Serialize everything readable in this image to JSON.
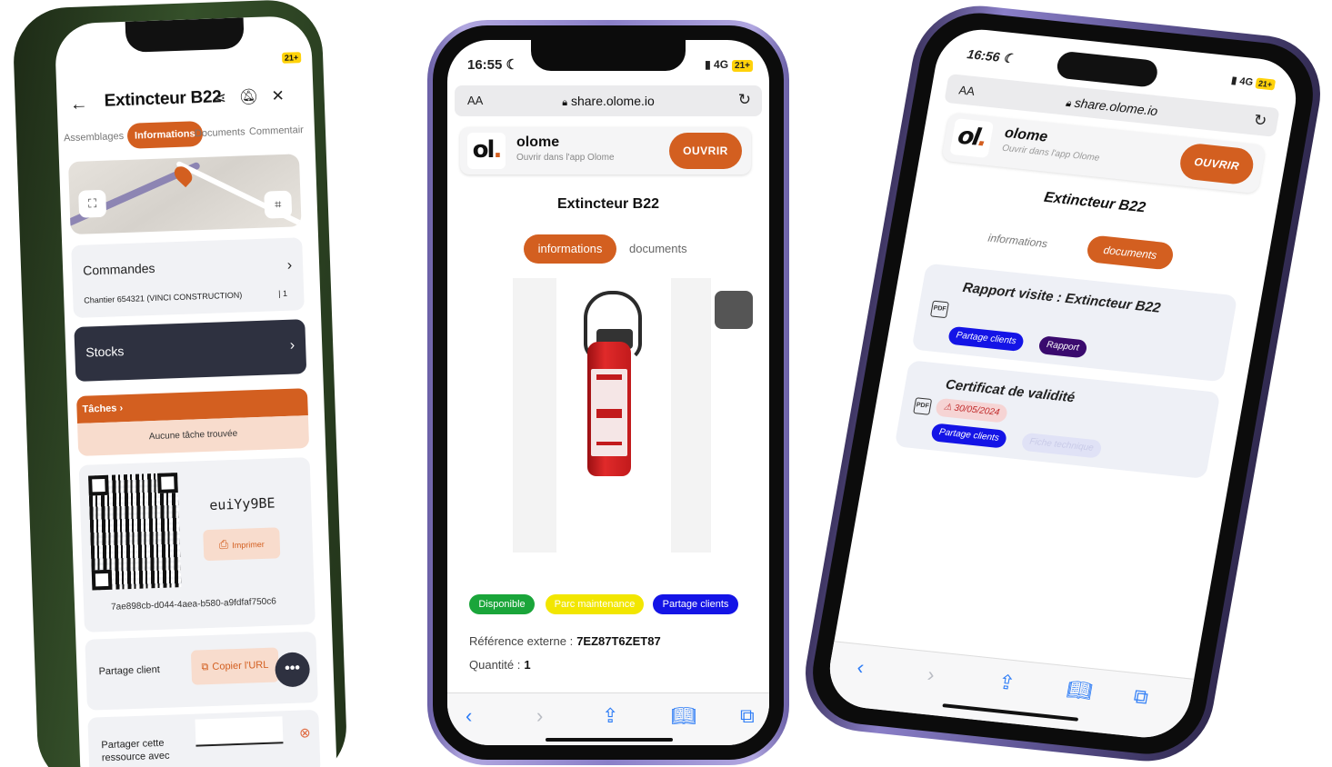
{
  "phone1": {
    "battery": "21+",
    "title": "Extincteur B22",
    "tabs": [
      "Assemblages",
      "Informations",
      "Documents",
      "Commentair"
    ],
    "commandes": {
      "title": "Commandes",
      "detail": "Chantier 654321 (VINCI CONSTRUCTION)",
      "count": "| 1"
    },
    "stocks": {
      "title": "Stocks"
    },
    "taches": {
      "title": "Tâches",
      "empty": "Aucune tâche trouvée"
    },
    "qr": {
      "code": "euiYy9BE",
      "print_label": "Imprimer",
      "uuid": "7ae898cb-d044-4aea-b580-a9fdfaf750c6"
    },
    "share": {
      "label": "Partage client",
      "copy_label": "Copier l'URL",
      "fab": "•••",
      "share_with_line1": "Partager cette",
      "share_with_line2": "ressource avec"
    }
  },
  "phone2": {
    "time": "16:55",
    "network": "4G",
    "battery": "21+",
    "aa": "AA",
    "url": "share.olome.io",
    "brand": "olome",
    "brand_sub": "Ouvrir dans l'app Olome",
    "logo": "ol",
    "open_label": "OUVRIR",
    "title": "Extincteur B22",
    "tab_active": "informations",
    "tab_other": "documents",
    "badges": [
      {
        "label": "Disponible",
        "bg": "#1aa53a",
        "fg": "#ffffff"
      },
      {
        "label": "Parc maintenance",
        "bg": "#f2e600",
        "fg": "#ffffff"
      },
      {
        "label": "Partage clients",
        "bg": "#1414e6",
        "fg": "#ffffff"
      }
    ],
    "ref_label": "Référence externe :",
    "ref_value": "7EZ87T6ZET87",
    "qty_label": "Quantité :",
    "qty_value": "1"
  },
  "phone3": {
    "time": "16:56",
    "network": "4G",
    "battery": "21+",
    "aa": "AA",
    "url": "share.olome.io",
    "brand": "olome",
    "brand_sub": "Ouvrir dans l'app Olome",
    "logo": "ol",
    "open_label": "OUVRIR",
    "title": "Extincteur B22",
    "tab_other": "informations",
    "tab_active": "documents",
    "doc1": {
      "title": "Rapport visite : Extincteur B22",
      "badges": [
        "Partage clients",
        "Rapport"
      ]
    },
    "doc2": {
      "title": "Certificat de validité",
      "date": "30/05/2024",
      "badges": [
        "Partage clients",
        "Fiche technique"
      ]
    }
  },
  "colors": {
    "accent": "#d35f20",
    "dark": "#2e3140",
    "blue_badge": "#1414e6",
    "purple_badge": "#3a0a6e",
    "ios_blue": "#2d7cf6"
  }
}
